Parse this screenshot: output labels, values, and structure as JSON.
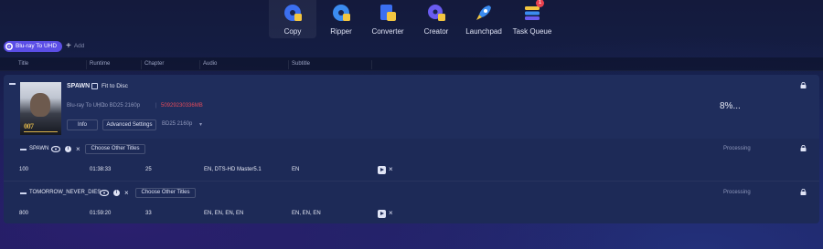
{
  "nav": {
    "items": [
      {
        "label": "Copy",
        "icon": "copy-disc-icon",
        "active": true
      },
      {
        "label": "Ripper",
        "icon": "ripper-disc-icon"
      },
      {
        "label": "Converter",
        "icon": "converter-icon"
      },
      {
        "label": "Creator",
        "icon": "creator-icon"
      },
      {
        "label": "Launchpad",
        "icon": "rocket-icon"
      },
      {
        "label": "Task Queue",
        "icon": "task-queue-icon",
        "badge": "1"
      }
    ]
  },
  "mode": {
    "label": "Blu-ray To UHD",
    "add_label": "Add"
  },
  "columns": {
    "title": "Title",
    "runtime": "Runtime",
    "chapter": "Chapter",
    "audio": "Audio",
    "subtitle": "Subtitle"
  },
  "task": {
    "name": "SPAWN",
    "fit_to_disc": "Fit to Disc",
    "source": "Blu-ray To UHD",
    "target": "to BD25 2160p",
    "size": "50929230336MB",
    "info_button": "Info",
    "advanced_button": "Advanced Settings",
    "output_select": "BD25 2160p",
    "progress": "8%...",
    "poster_logo": "007"
  },
  "titles": [
    {
      "name": "SPAWN",
      "choose_label": "Choose Other Titles",
      "status": "Processing",
      "id": "100",
      "runtime": "01:38:33",
      "chapter": "25",
      "audio": "EN, DTS-HD Master5.1",
      "subtitle": "EN"
    },
    {
      "name": "TOMORROW_NEVER_DIES",
      "choose_label": "Choose Other Titles",
      "status": "Processing",
      "id": "800",
      "runtime": "01:59:20",
      "chapter": "33",
      "audio": "EN, EN, EN, EN",
      "subtitle": "EN, EN, EN"
    }
  ],
  "colors": {
    "accent": "#5b4ee6",
    "size_warning": "#e04a5a",
    "background": "#15204a"
  }
}
